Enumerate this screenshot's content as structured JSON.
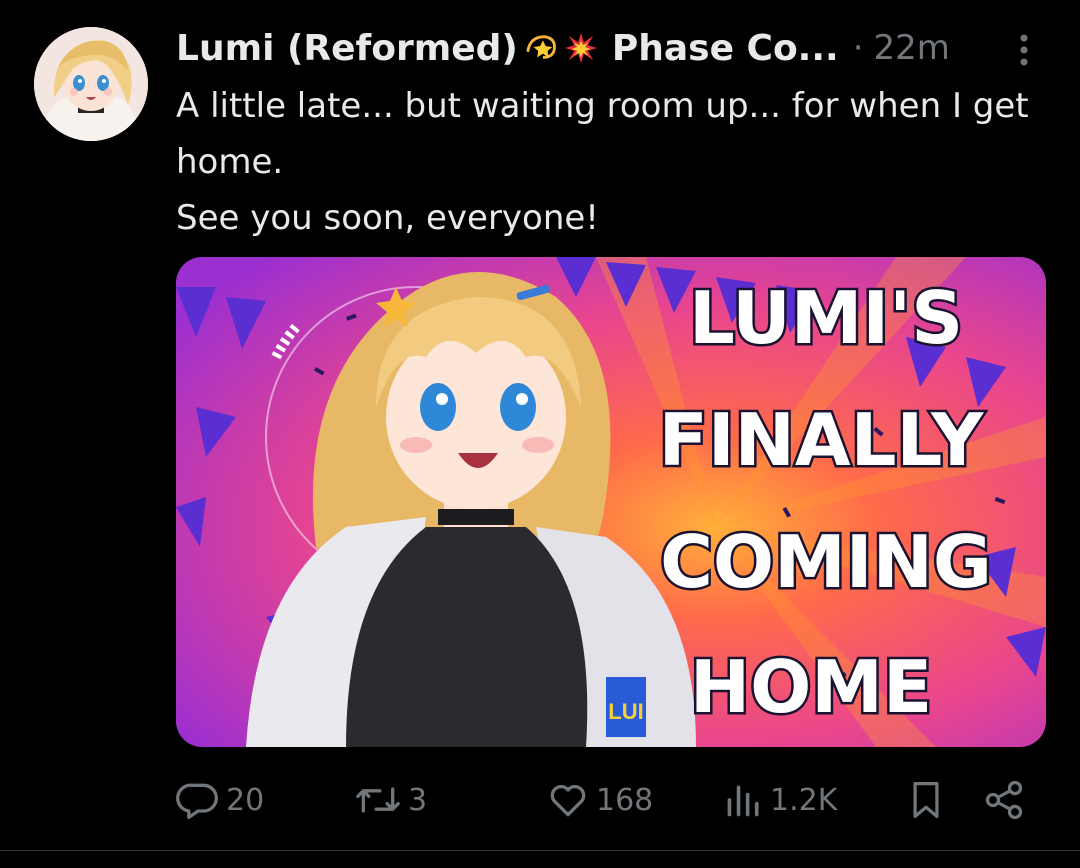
{
  "post": {
    "author_name": "Lumi (Reformed)",
    "author_name_2": "Phase Co...",
    "separator": "·",
    "time": "22m",
    "text_lines": [
      "A little late... but waiting room up... for when I get home.",
      "See you soon, everyone!"
    ],
    "media": {
      "title_lines": [
        "LUMI'S",
        "FINALLY",
        "COMING",
        "HOME"
      ],
      "jacket_text": "LUI"
    }
  },
  "actions": {
    "replies": "20",
    "reposts": "3",
    "likes": "168",
    "views": "1.2K"
  },
  "colors": {
    "background": "#000000",
    "text": "#e7e9ea",
    "muted": "#71767b",
    "media_pink": "#e8458f",
    "media_purple": "#5b2ed1",
    "media_orange": "#ff9a2e"
  },
  "icons": [
    "dizzy-emoji-icon",
    "collision-emoji-icon",
    "more-icon",
    "reply-icon",
    "repost-icon",
    "like-icon",
    "views-icon",
    "bookmark-icon",
    "share-icon"
  ]
}
